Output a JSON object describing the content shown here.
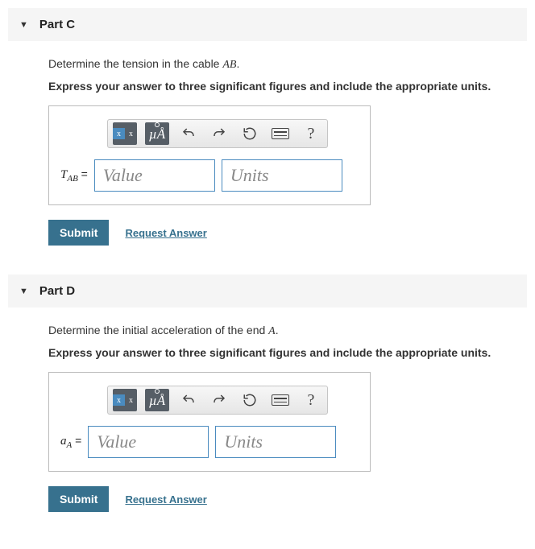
{
  "parts": [
    {
      "title": "Part C",
      "prompt_pre": "Determine the tension in the cable ",
      "prompt_var": "AB",
      "prompt_post": ".",
      "instruction": "Express your answer to three significant figures and include the appropriate units.",
      "var_main": "T",
      "var_sub": "AB",
      "eq": " =",
      "value_placeholder": "Value",
      "units_placeholder": "Units",
      "submit": "Submit",
      "request": "Request Answer"
    },
    {
      "title": "Part D",
      "prompt_pre": "Determine the initial acceleration of the end ",
      "prompt_var": "A",
      "prompt_post": ".",
      "instruction": "Express your answer to three significant figures and include the appropriate units.",
      "var_main": "a",
      "var_sub": "A",
      "eq": " =",
      "value_placeholder": "Value",
      "units_placeholder": "Units",
      "submit": "Submit",
      "request": "Request Answer"
    }
  ],
  "toolbar": {
    "mu_label": "µÅ",
    "help": "?"
  }
}
